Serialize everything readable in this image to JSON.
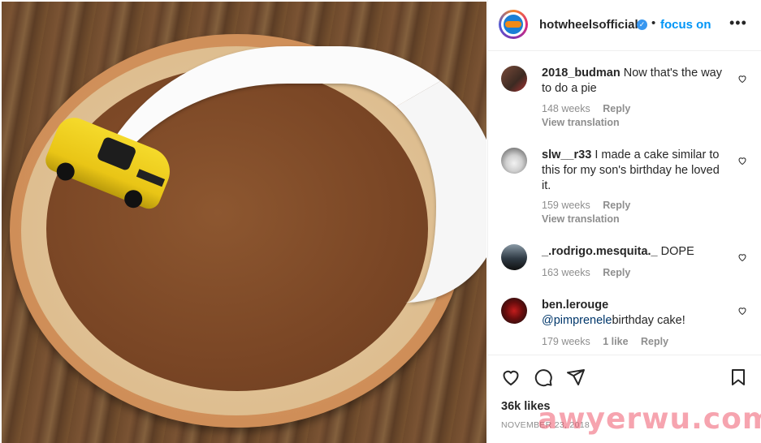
{
  "post": {
    "username": "hotwheelsofficial",
    "separator": "•",
    "follow_label": "focus on",
    "more_label": "•••",
    "image_alt": "Pumpkin pie with whipped cream and a yellow toy car"
  },
  "comments": [
    {
      "user": "2018_budman",
      "text": "Now that's the way to do a pie",
      "time": "148 weeks",
      "reply": "Reply",
      "likes": "",
      "translation": "View translation"
    },
    {
      "user": "slw__r33",
      "text": "I made a cake similar to this for my son's birthday he loved it.",
      "time": "159 weeks",
      "reply": "Reply",
      "likes": "",
      "translation": "View translation"
    },
    {
      "user": "_.rodrigo.mesquita._",
      "text": "DOPE",
      "time": "163 weeks",
      "reply": "Reply",
      "likes": "",
      "translation": ""
    },
    {
      "user": "ben.lerouge",
      "mention": "@pimprenele",
      "text": "birthday cake!",
      "time": "179 weeks",
      "likes": "1 like",
      "reply": "Reply"
    }
  ],
  "footer": {
    "likes": "36k likes",
    "date": "NOVEMBER 23, 2018"
  },
  "watermark": "awyerwu.com",
  "icons": {
    "like": "heart-icon",
    "comment": "comment-icon",
    "share": "send-icon",
    "save": "bookmark-icon",
    "verified": "verified-badge-icon",
    "more": "more-options-icon"
  }
}
